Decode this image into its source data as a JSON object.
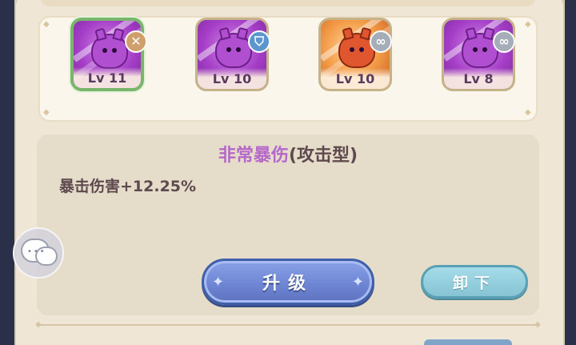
{
  "slots": [
    {
      "level": "Lv 11",
      "theme": "purple",
      "selected": true,
      "badge": "remove",
      "badge_icon": "✕",
      "art": "purple-cat-swirl"
    },
    {
      "level": "Lv 10",
      "theme": "purple",
      "selected": false,
      "badge": "shield",
      "badge_icon": "⛉",
      "art": "purple-cat-dark"
    },
    {
      "level": "Lv 10",
      "theme": "orange",
      "selected": false,
      "badge": "link",
      "badge_icon": "∞",
      "art": "orange-lion-slash"
    },
    {
      "level": "Lv 8",
      "theme": "purple",
      "selected": false,
      "badge": "link",
      "badge_icon": "∞",
      "art": "purple-cat-arms-crossed"
    }
  ],
  "skill": {
    "name": "非常暴伤",
    "type": "(攻击型)",
    "description": "暴击伤害+12.25%"
  },
  "buttons": {
    "upgrade": "升级",
    "unequip": "卸下"
  },
  "colors": {
    "selected_border": "#79b56a",
    "skill_name": "#b468c8",
    "upgrade_button": "#6f86d4",
    "unequip_button": "#86c3d4"
  },
  "icons": {
    "chat": "chat-bubble-icon",
    "remove": "close-icon",
    "shield": "shield-icon",
    "link": "link-icon"
  }
}
